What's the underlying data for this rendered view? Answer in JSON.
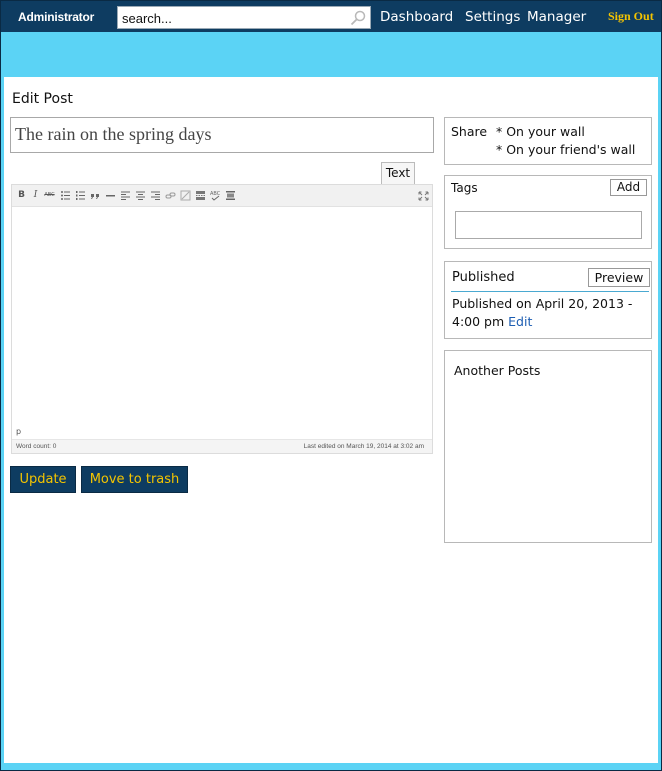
{
  "header": {
    "brand": "Administrator",
    "search_placeholder": "search...",
    "nav": [
      "Dashboard",
      "Settings",
      "Manager"
    ],
    "sign_out": "Sign Out",
    "bg_color": "#0e3c61",
    "accent_color": "#f4c400"
  },
  "page": {
    "title": "Edit Post",
    "background_color": "#5bd3f5"
  },
  "editor": {
    "post_title": "The rain on the spring days",
    "text_tab": "Text",
    "toolbar_icons": [
      "bold-icon",
      "italic-icon",
      "strikethrough-icon",
      "bullet-list-icon",
      "numbered-list-icon",
      "blockquote-icon",
      "horizontal-rule-icon",
      "align-left-icon",
      "align-center-icon",
      "align-right-icon",
      "link-icon",
      "unlink-icon",
      "read-more-icon",
      "spellcheck-icon",
      "toolbar-toggle-icon",
      "fullscreen-icon"
    ],
    "toolbar_glyphs": {
      "bold": "B",
      "italic": "I",
      "strikethrough": "ABC"
    },
    "path": "p",
    "word_count": "Word count: 0",
    "last_edited": "Last edited on March 19, 2014 at 3:02 am"
  },
  "actions": {
    "update": "Update",
    "trash": "Move to trash"
  },
  "share": {
    "label": "Share",
    "options": [
      "* On your wall",
      "* On your friend's wall"
    ]
  },
  "tags": {
    "label": "Tags",
    "add": "Add",
    "input_value": ""
  },
  "published": {
    "label": "Published",
    "preview": "Preview",
    "text": "Published on April 20, 2013 - 4:00 pm",
    "edit": "Edit"
  },
  "another": {
    "label": "Another Posts"
  }
}
